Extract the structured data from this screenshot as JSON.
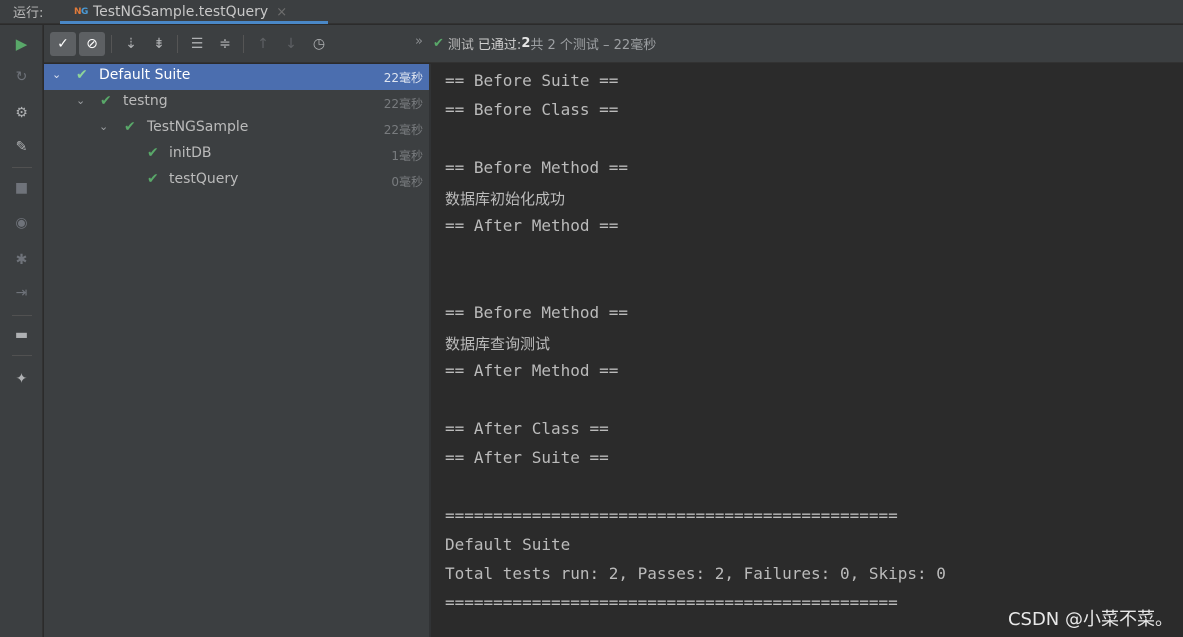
{
  "tabbar": {
    "run_label": "运行:",
    "tab_icon": "NG",
    "tab_title": "TestNGSample.testQuery",
    "close_glyph": "×"
  },
  "left_toolbar": {
    "icons": [
      "run-icon",
      "rerun-failed-icon",
      "debug-icon",
      "settings-icon",
      "stop-icon",
      "screenshot-icon",
      "bug-icon",
      "exit-icon",
      "layout-icon",
      "pin-icon"
    ]
  },
  "toolbar": {
    "buttons": [
      "show-passed-icon",
      "show-ignored-icon",
      "sort-alpha-icon",
      "sort-duration-icon",
      "expand-all-icon",
      "collapse-all-icon",
      "previous-icon",
      "next-icon",
      "history-icon"
    ],
    "status": {
      "check": "✔",
      "prefix": "测试",
      "passed": "已通过:",
      "count": "2",
      "total": "共 2 个测试 – 22毫秒"
    }
  },
  "tree": {
    "items": [
      {
        "label": "Default Suite",
        "time": "22毫秒"
      },
      {
        "label": "testng",
        "time": "22毫秒"
      },
      {
        "label": "TestNGSample",
        "time": "22毫秒"
      },
      {
        "label": "initDB",
        "time": "1毫秒"
      },
      {
        "label": "testQuery",
        "time": "0毫秒"
      }
    ]
  },
  "console": {
    "lines": [
      "== Before Suite ==",
      "== Before Class ==",
      "== Before Method ==",
      "数据库初始化成功",
      "== After Method ==",
      "== Before Method ==",
      "数据库查询测试",
      "== After Method ==",
      "== After Class ==",
      "== After Suite ==",
      "===============================================",
      "Default Suite",
      "Total tests run: 2, Passes: 2, Failures: 0, Skips: 0",
      "==============================================="
    ]
  },
  "watermark": "CSDN @小菜不菜。"
}
